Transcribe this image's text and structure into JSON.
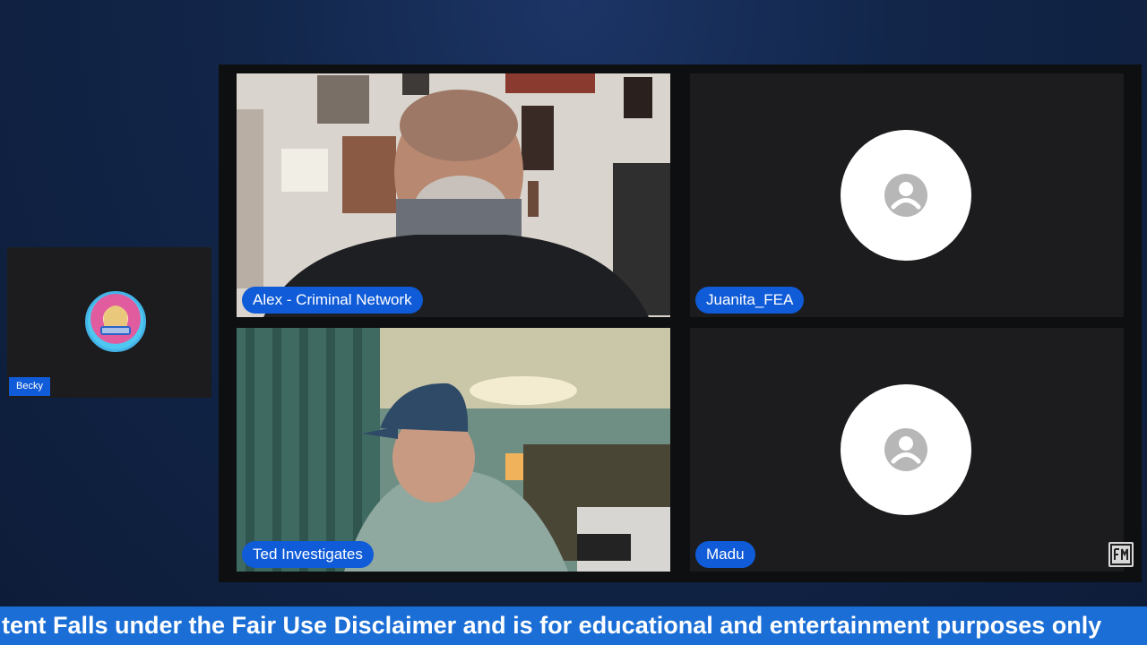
{
  "participants": {
    "alex": {
      "name": "Alex - Criminal Network"
    },
    "juanita": {
      "name": "Juanita_FEA"
    },
    "ted": {
      "name": "Ted Investigates"
    },
    "madu": {
      "name": "Madu"
    },
    "becky": {
      "name": "Becky"
    }
  },
  "ticker": {
    "text": "tent Falls under the Fair Use Disclaimer and is for educational and entertainment purposes only"
  },
  "colors": {
    "name_tag": "#0f5bd8",
    "ticker_bg": "#1a6ed6",
    "tile_bg": "#1c1c1e"
  },
  "icons": {
    "avatar_placeholder": "person-icon",
    "corner_logo": "channel-logo"
  }
}
